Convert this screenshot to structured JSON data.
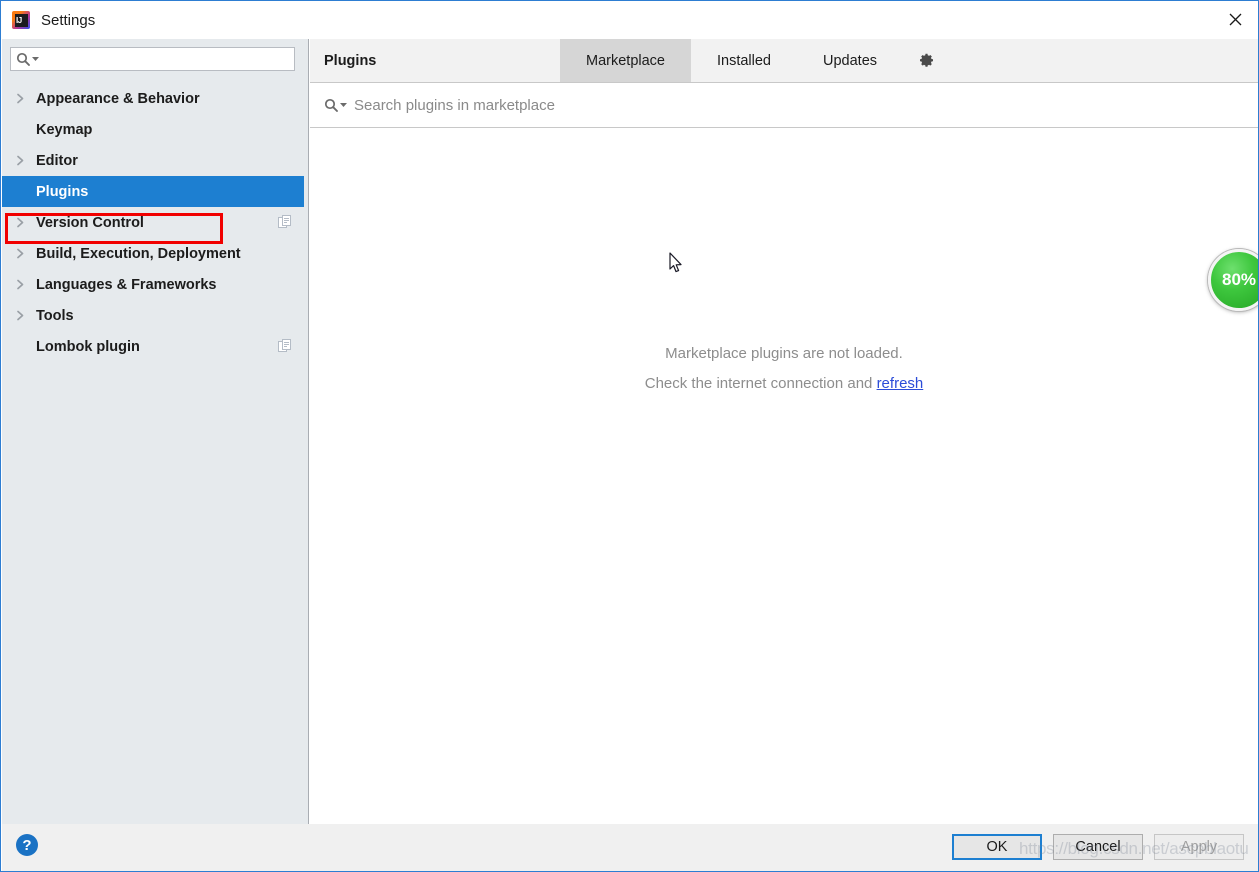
{
  "window": {
    "title": "Settings",
    "app_icon": "intellij-idea-icon",
    "close_icon": "close-icon"
  },
  "sidebar": {
    "search": {
      "value": "",
      "placeholder": "",
      "icon": "search-icon"
    },
    "items": [
      {
        "label": "Appearance & Behavior",
        "expandable": true,
        "selected": false,
        "project_icon": false
      },
      {
        "label": "Keymap",
        "expandable": false,
        "selected": false,
        "project_icon": false
      },
      {
        "label": "Editor",
        "expandable": true,
        "selected": false,
        "project_icon": false
      },
      {
        "label": "Plugins",
        "expandable": false,
        "selected": true,
        "project_icon": false
      },
      {
        "label": "Version Control",
        "expandable": true,
        "selected": false,
        "project_icon": true
      },
      {
        "label": "Build, Execution, Deployment",
        "expandable": true,
        "selected": false,
        "project_icon": false
      },
      {
        "label": "Languages & Frameworks",
        "expandable": true,
        "selected": false,
        "project_icon": false
      },
      {
        "label": "Tools",
        "expandable": true,
        "selected": false,
        "project_icon": false
      },
      {
        "label": "Lombok plugin",
        "expandable": false,
        "selected": false,
        "project_icon": true
      }
    ]
  },
  "main": {
    "title": "Plugins",
    "tabs": [
      {
        "label": "Marketplace",
        "active": true
      },
      {
        "label": "Installed",
        "active": false
      },
      {
        "label": "Updates",
        "active": false
      }
    ],
    "gear_icon": "gear-icon",
    "search": {
      "value": "",
      "placeholder": "Search plugins in marketplace",
      "icon": "search-icon"
    },
    "empty_state": {
      "line1": "Marketplace plugins are not loaded.",
      "line2_prefix": "Check the internet connection and ",
      "link_label": "refresh"
    }
  },
  "footer": {
    "help_label": "?",
    "ok_label": "OK",
    "cancel_label": "Cancel",
    "apply_label": "Apply"
  },
  "overlays": {
    "watermark": "https://blog.csdn.net/ascpblaotu",
    "zoom_badge": "80%",
    "annotation_color": "#f10000",
    "selection_color": "#1d7fd1"
  }
}
